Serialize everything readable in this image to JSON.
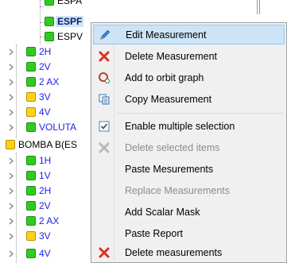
{
  "tree": {
    "partial_top_label": "ESPA",
    "selected_label": "ESPF",
    "espv_label": "ESPV",
    "group1": [
      {
        "label": "2H",
        "color": "green"
      },
      {
        "label": "2V",
        "color": "green"
      },
      {
        "label": "2 AX",
        "color": "green"
      },
      {
        "label": "3V",
        "color": "yellow"
      },
      {
        "label": "4V",
        "color": "yellow"
      },
      {
        "label": "VOLUTA",
        "color": "green"
      }
    ],
    "parent_label": "BOMBA B(ES",
    "group2": [
      {
        "label": "1H",
        "color": "green"
      },
      {
        "label": "1V",
        "color": "green"
      },
      {
        "label": "2H",
        "color": "green"
      },
      {
        "label": "2V",
        "color": "green"
      },
      {
        "label": "2 AX",
        "color": "green"
      },
      {
        "label": "3V",
        "color": "yellow"
      },
      {
        "label": "4V",
        "color": "green"
      }
    ]
  },
  "context_menu": {
    "items": [
      {
        "label": "Edit Measurement",
        "icon": "pencil-icon",
        "enabled": true,
        "highlighted": true
      },
      {
        "label": "Delete Measurement",
        "icon": "red-x-icon",
        "enabled": true
      },
      {
        "label": "Add to orbit graph",
        "icon": "orbit-graph-icon",
        "enabled": true
      },
      {
        "label": "Copy Measurement",
        "icon": "copy-icon",
        "enabled": true
      },
      {
        "label": "Enable multiple selection",
        "icon": "checkbox-checked-icon",
        "enabled": true
      },
      {
        "label": "Delete selected items",
        "icon": "gray-x-icon",
        "enabled": false
      },
      {
        "label": "Paste Mesurements",
        "enabled": true
      },
      {
        "label": "Replace Measurements",
        "enabled": false
      },
      {
        "label": "Add Scalar Mask",
        "enabled": true
      },
      {
        "label": "Paste Report",
        "enabled": true
      },
      {
        "label": "Delete measurements",
        "icon": "red-x-icon",
        "enabled": true
      }
    ]
  },
  "colors": {
    "green": "#2fcc1f",
    "yellow": "#ffd21a",
    "label_blue": "#1d1df0",
    "menu_bg": "#f0f0f0",
    "menu_highlight": "#cce4f7"
  }
}
